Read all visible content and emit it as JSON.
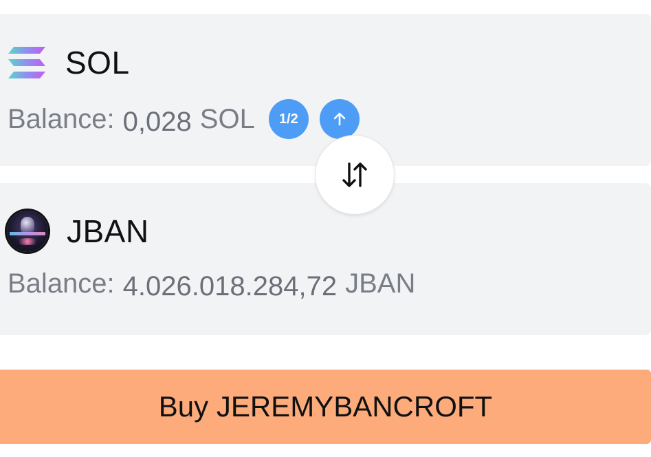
{
  "pay_token": {
    "symbol": "SOL",
    "logo_icon": "solana-logo-icon",
    "balance_label": "Balance:",
    "balance_amount": "0,028",
    "balance_unit": "SOL",
    "half_label": "1/2",
    "max_icon": "arrow-up-icon"
  },
  "swap_icon": "swap-arrows-icon",
  "receive_token": {
    "symbol": "JBAN",
    "logo_icon": "jban-token-logo-icon",
    "balance_label": "Balance:",
    "balance_amount": "4.026.018.284,72",
    "balance_unit": "JBAN"
  },
  "buy_button": {
    "label": "Buy JEREMYBANCROFT"
  },
  "colors": {
    "card_bg": "#f2f3f5",
    "accent_blue": "#4d9cf5",
    "buy_orange": "#fdab7b",
    "muted_text": "#7a7d86"
  }
}
